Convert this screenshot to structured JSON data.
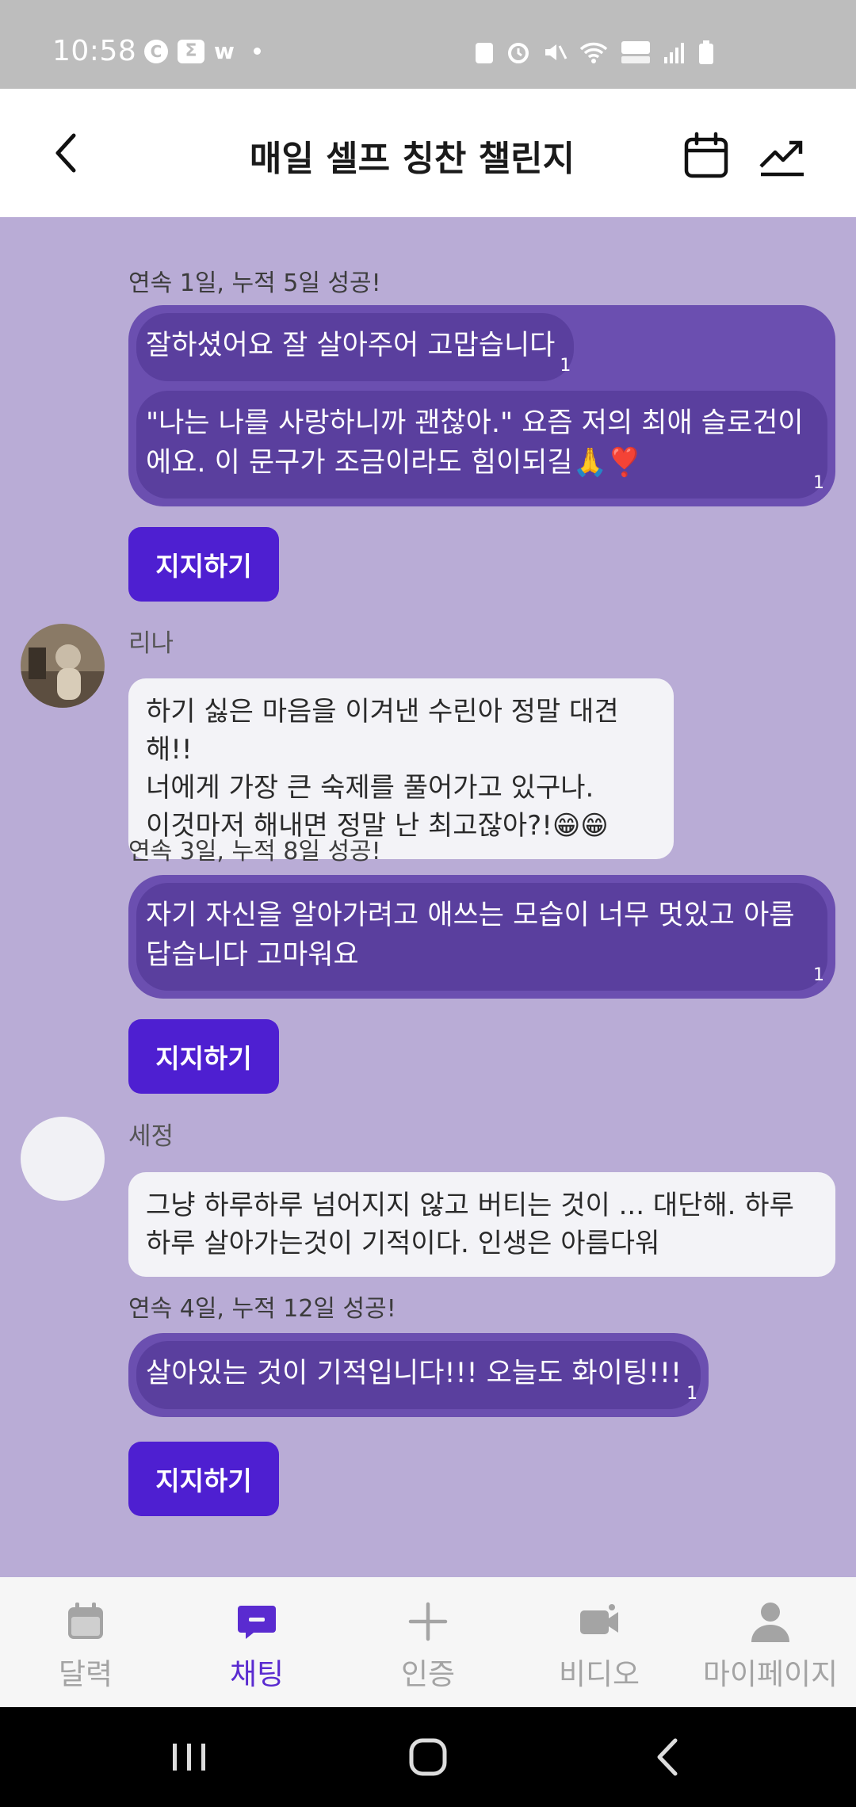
{
  "status_bar": {
    "time": "10:58",
    "left_icons": [
      "c-circle-icon",
      "sigma-icon",
      "w-icon",
      "dot-icon"
    ],
    "right_icons": [
      "recycle-icon",
      "alarm-icon",
      "mute-icon",
      "wifi-icon",
      "hd-voice-icon",
      "signal-icon",
      "battery-icon"
    ]
  },
  "header": {
    "title": "매일 셀프 칭찬 챌린지",
    "back_icon": "chevron-left-icon",
    "actions": [
      "calendar-icon",
      "trend-icon"
    ]
  },
  "chat": {
    "messages": [
      {
        "type": "certification",
        "streak": "연속 1일, 누적 5일 성공!",
        "items": [
          {
            "text": "잘하셨어요 잘 살아주어 고맙습니다",
            "count": "1"
          },
          {
            "text": "\"나는 나를 사랑하니까 괜찮아.\" 요즘 저의 최애 슬로건이에요. 이 문구가 조금이라도 힘이되길🙏❣️",
            "count": "1"
          }
        ],
        "support_label": "지지하기"
      },
      {
        "type": "comment",
        "sender": "리나",
        "text": "하기 싫은 마음을 이겨낸 수린아 정말 대견해!!\n너에게 가장 큰 숙제를 풀어가고 있구나.\n이것마저 해내면 정말 난 최고잖아?!😁😁"
      },
      {
        "type": "certification",
        "streak": "연속 3일, 누적 8일 성공!",
        "items": [
          {
            "text": "자기 자신을 알아가려고 애쓰는 모습이 너무 멋있고 아름답습니다 고마워요",
            "count": "1"
          }
        ],
        "support_label": "지지하기"
      },
      {
        "type": "comment",
        "sender": "세정",
        "text": "그냥 하루하루 넘어지지 않고 버티는 것이 ... 대단해. 하루하루 살아가는것이 기적이다. 인생은 아름다워"
      },
      {
        "type": "certification",
        "streak": "연속 4일, 누적 12일 성공!",
        "items": [
          {
            "text": "살아있는 것이 기적입니다!!! 오늘도 화이팅!!!",
            "count": "1"
          }
        ],
        "support_label": "지지하기"
      }
    ]
  },
  "bottom_nav": {
    "items": [
      {
        "label": "달력",
        "icon": "calendar-icon",
        "active": false
      },
      {
        "label": "채팅",
        "icon": "chat-icon",
        "active": true
      },
      {
        "label": "인증",
        "icon": "plus-icon",
        "active": false
      },
      {
        "label": "비디오",
        "icon": "video-icon",
        "active": false
      },
      {
        "label": "마이페이지",
        "icon": "person-icon",
        "active": false
      }
    ]
  },
  "system_nav": [
    "recent-apps-icon",
    "home-icon",
    "back-icon"
  ],
  "colors": {
    "chat_bg": "#b9acd6",
    "cert_outer": "#6b4fb0",
    "cert_inner": "#5a3f9e",
    "accent": "#4e1fd1",
    "nav_active": "#5a2bd0"
  }
}
